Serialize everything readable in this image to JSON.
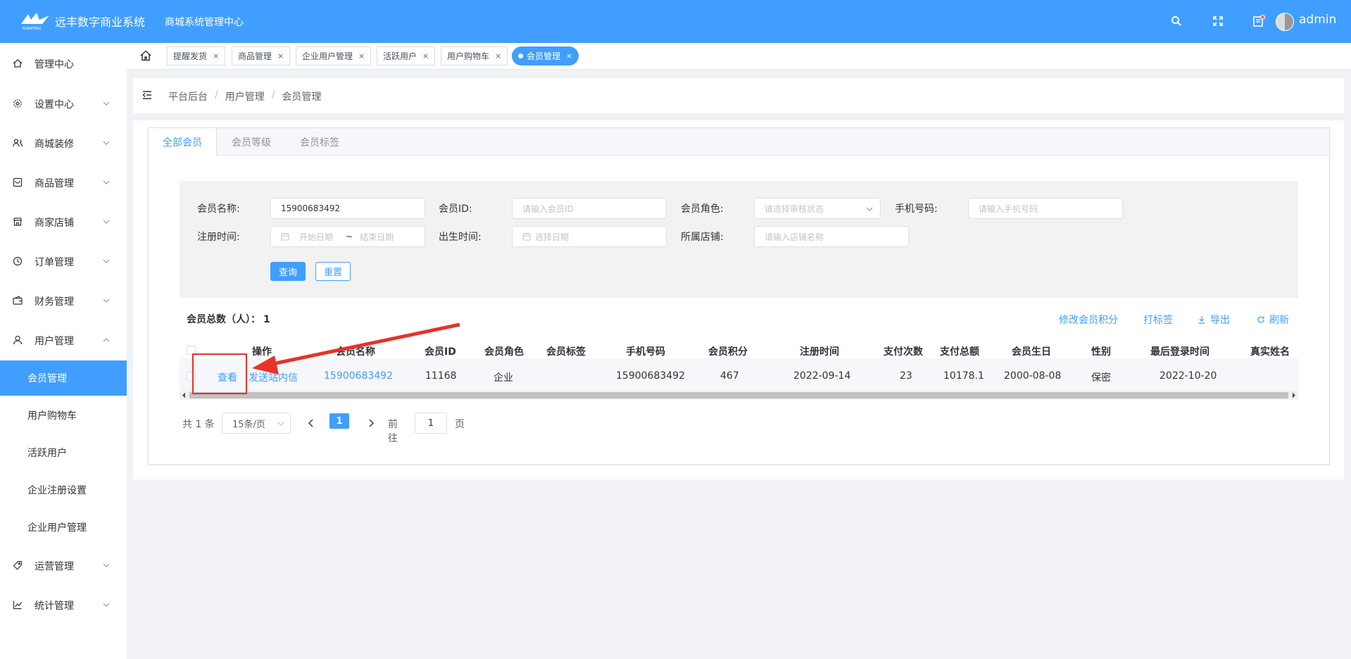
{
  "topbar": {
    "app_title": "远丰数字商业系统",
    "logo_text": "YUANFENG",
    "sub_title": "商城系统管理中心",
    "username": "admin"
  },
  "sidebar": {
    "items": [
      {
        "label": "管理中心",
        "icon": "home-icon",
        "has_arrow": false
      },
      {
        "label": "设置中心",
        "icon": "gear-icon",
        "has_arrow": true
      },
      {
        "label": "商城装修",
        "icon": "people-icon",
        "has_arrow": true
      },
      {
        "label": "商品管理",
        "icon": "box-icon",
        "has_arrow": true
      },
      {
        "label": "商家店铺",
        "icon": "store-icon",
        "has_arrow": true
      },
      {
        "label": "订单管理",
        "icon": "order-icon",
        "has_arrow": true
      },
      {
        "label": "财务管理",
        "icon": "wallet-icon",
        "has_arrow": true
      },
      {
        "label": "用户管理",
        "icon": "user-icon",
        "has_arrow": true,
        "expanded": true
      }
    ],
    "sub_items": [
      {
        "label": "会员管理",
        "active": true
      },
      {
        "label": "用户购物车",
        "active": false
      },
      {
        "label": "活跃用户",
        "active": false
      },
      {
        "label": "企业注册设置",
        "active": false
      },
      {
        "label": "企业用户管理",
        "active": false
      }
    ],
    "bottom_items": [
      {
        "label": "运营管理",
        "icon": "tag-icon",
        "has_arrow": true
      },
      {
        "label": "统计管理",
        "icon": "chart-icon",
        "has_arrow": true
      }
    ]
  },
  "tabs": [
    {
      "label": "提醒发货",
      "active": false
    },
    {
      "label": "商品管理",
      "active": false
    },
    {
      "label": "企业用户管理",
      "active": false
    },
    {
      "label": "活跃用户",
      "active": false
    },
    {
      "label": "用户购物车",
      "active": false
    },
    {
      "label": "会员管理",
      "active": true
    }
  ],
  "breadcrumb": [
    "平台后台",
    "用户管理",
    "会员管理"
  ],
  "card_tabs": [
    {
      "label": "全部会员",
      "active": true
    },
    {
      "label": "会员等级",
      "active": false
    },
    {
      "label": "会员标签",
      "active": false
    }
  ],
  "filter": {
    "member_name_label": "会员名称:",
    "member_name_value": "15900683492",
    "member_id_label": "会员ID:",
    "member_id_placeholder": "请输入会员ID",
    "member_role_label": "会员角色:",
    "member_role_placeholder": "请选择审核状态",
    "phone_label": "手机号码:",
    "phone_placeholder": "请输入手机号码",
    "reg_time_label": "注册时间:",
    "reg_start_placeholder": "开始日期",
    "reg_sep": "~",
    "reg_end_placeholder": "结束日期",
    "birth_label": "出生时间:",
    "birth_placeholder": "选择日期",
    "store_label": "所属店铺:",
    "store_placeholder": "请输入店铺名称",
    "query_btn": "查询",
    "reset_btn": "重置"
  },
  "summary": {
    "label": "会员总数（人）：",
    "count": "1"
  },
  "actions": {
    "modify_points": "修改会员积分",
    "tag": "打标签",
    "export": "导出",
    "refresh": "刷新"
  },
  "table": {
    "headers": [
      "操作",
      "会员名称",
      "会员ID",
      "会员角色",
      "会员标签",
      "手机号码",
      "会员积分",
      "注册时间",
      "支付次数",
      "支付总额",
      "会员生日",
      "性别",
      "最后登录时间",
      "真实姓名"
    ],
    "rows": [
      {
        "op_view": "查看",
        "op_msg": "发送站内信",
        "name": "15900683492",
        "id": "11168",
        "role": "企业",
        "tag": "",
        "phone": "15900683492",
        "points": "467",
        "reg_time": "2022-09-14",
        "pay_count": "23",
        "pay_total": "10178.1",
        "birthday": "2000-08-08",
        "gender": "保密",
        "last_login": "2022-10-20",
        "real_name": ""
      }
    ]
  },
  "pager": {
    "total": "共 1 条",
    "page_size": "15条/页",
    "current": "1",
    "goto_label": "前往",
    "goto_value": "1",
    "page_unit": "页"
  },
  "colors": {
    "primary": "#409eff",
    "annotation": "#e8322a"
  }
}
